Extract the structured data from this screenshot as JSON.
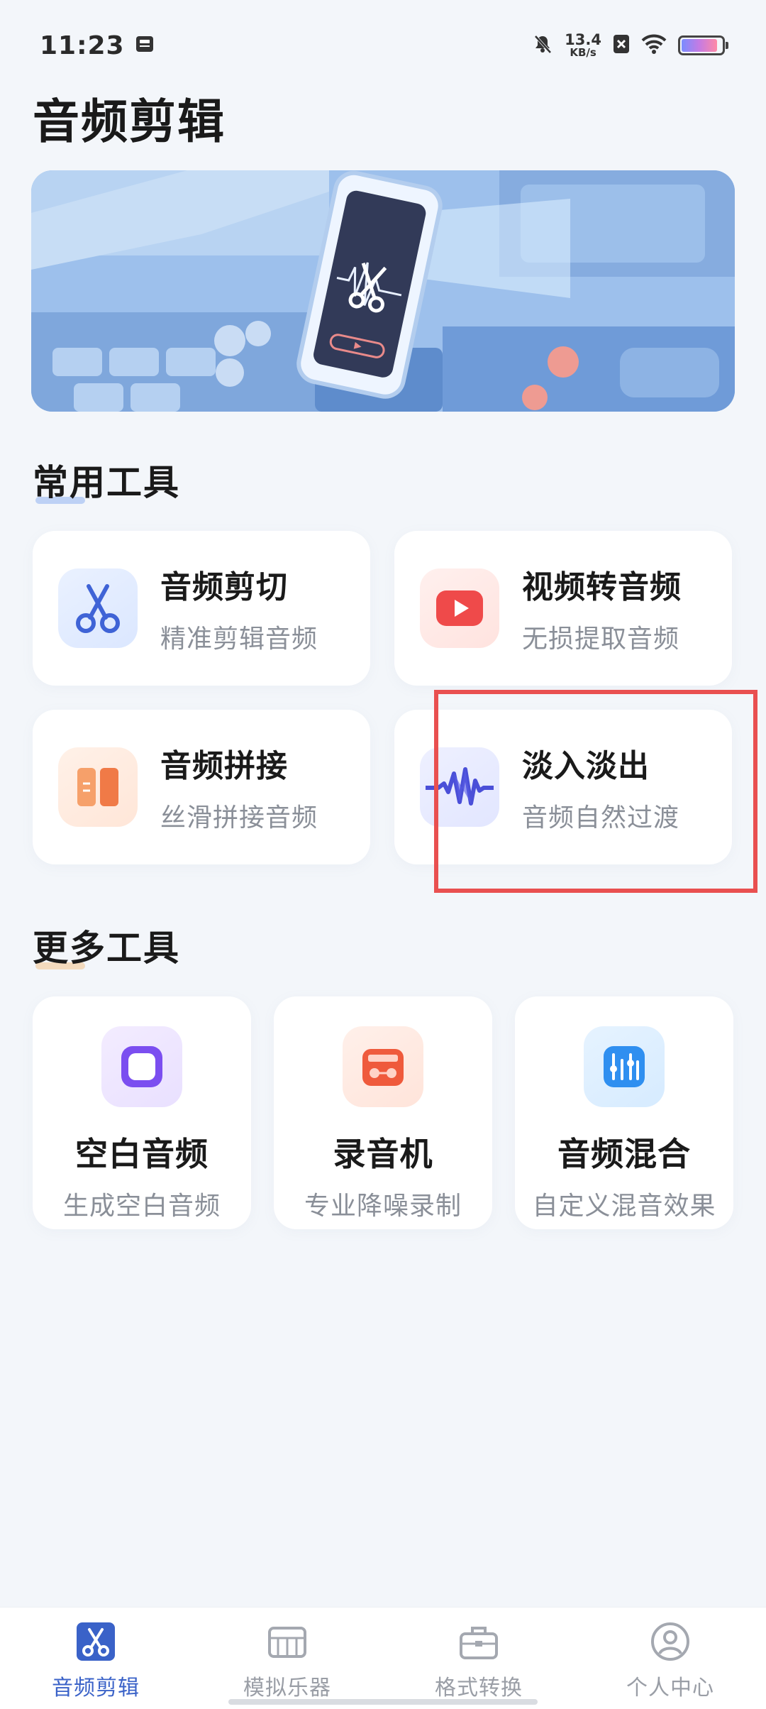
{
  "status_bar": {
    "time": "11:23",
    "net_speed_value": "13.4",
    "net_speed_unit": "KB/s",
    "battery_level": 0.9
  },
  "page": {
    "title": "音频剪辑"
  },
  "sections": {
    "common": "常用工具",
    "more": "更多工具"
  },
  "common_tools": [
    {
      "title": "音频剪切",
      "subtitle": "精准剪辑音频",
      "icon": "scissors-icon"
    },
    {
      "title": "视频转音频",
      "subtitle": "无损提取音频",
      "icon": "video-play-icon"
    },
    {
      "title": "音频拼接",
      "subtitle": "丝滑拼接音频",
      "icon": "splice-icon"
    },
    {
      "title": "淡入淡出",
      "subtitle": "音频自然过渡",
      "icon": "waveform-icon"
    }
  ],
  "more_tools": [
    {
      "title": "空白音频",
      "subtitle": "生成空白音频",
      "icon": "blank-square-icon"
    },
    {
      "title": "录音机",
      "subtitle": "专业降噪录制",
      "icon": "recorder-icon"
    },
    {
      "title": "音频混合",
      "subtitle": "自定义混音效果",
      "icon": "mixer-icon"
    }
  ],
  "bottom_nav": [
    {
      "label": "音频剪辑",
      "icon": "scissors-icon",
      "active": true
    },
    {
      "label": "模拟乐器",
      "icon": "piano-icon",
      "active": false
    },
    {
      "label": "格式转换",
      "icon": "toolbox-icon",
      "active": false
    },
    {
      "label": "个人中心",
      "icon": "user-icon",
      "active": false
    }
  ],
  "colors": {
    "accent": "#3a62c8",
    "highlight_border": "#e95050",
    "background": "#f3f6fa"
  }
}
